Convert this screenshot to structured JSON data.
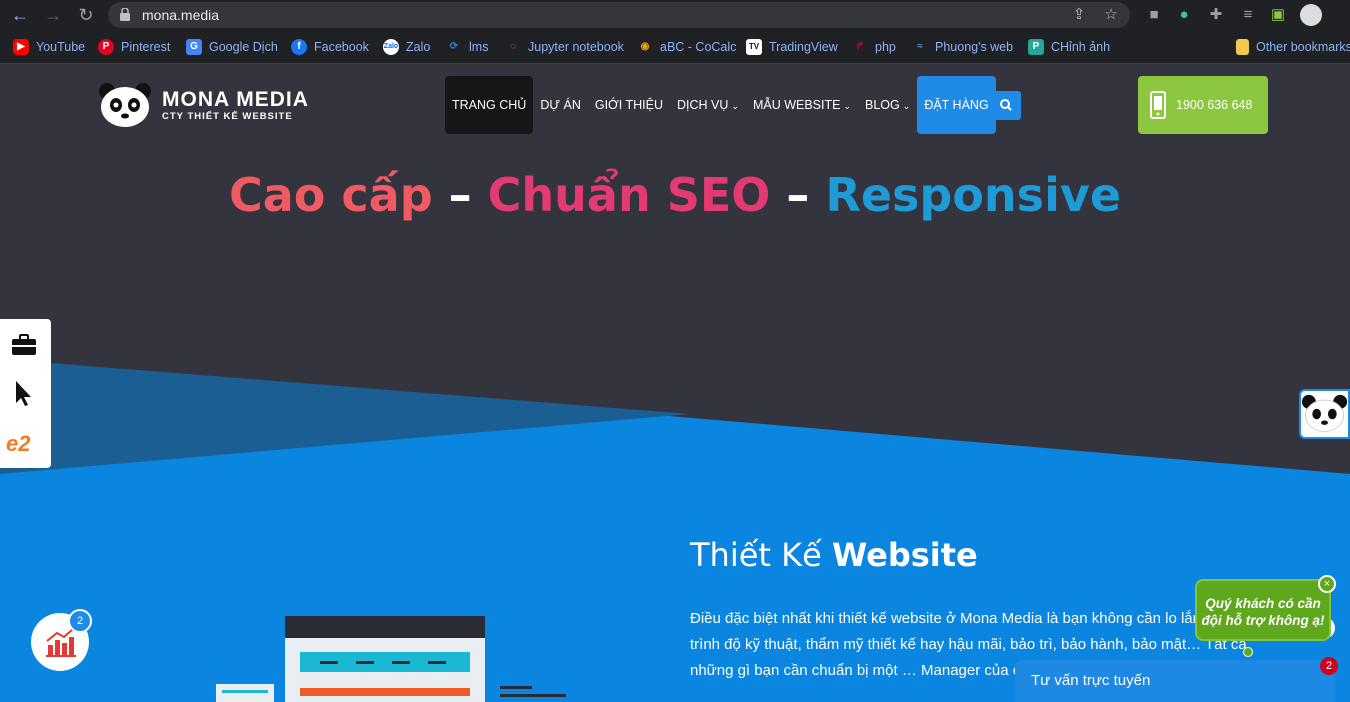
{
  "browser": {
    "url": "mona.media",
    "bookmarks": [
      {
        "label": "YouTube",
        "icon": "youtube-icon",
        "color": "#ff0000"
      },
      {
        "label": "Pinterest",
        "icon": "pinterest-icon",
        "color": "#e60023"
      },
      {
        "label": "Google Dịch",
        "icon": "google-translate-icon",
        "color": "#4285f4"
      },
      {
        "label": "Facebook",
        "icon": "facebook-icon",
        "color": "#1877f2"
      },
      {
        "label": "Zalo",
        "icon": "zalo-icon",
        "color": "#0068ff"
      },
      {
        "label": "lms",
        "icon": "lms-icon",
        "color": "#1e88e5"
      },
      {
        "label": "Jupyter notebook",
        "icon": "jupyter-icon",
        "color": "#f37626"
      },
      {
        "label": "aBC - CoCalc",
        "icon": "cocalc-icon",
        "color": "#f4a300"
      },
      {
        "label": "TradingView",
        "icon": "tradingview-icon",
        "color": "#131722"
      },
      {
        "label": "php",
        "icon": "php-icon",
        "color": "#d0021b"
      },
      {
        "label": "Phuong's web",
        "icon": "web-icon",
        "color": "#4a90e2"
      },
      {
        "label": "CHỉnh ảnh",
        "icon": "photo-edit-icon",
        "color": "#26a69a"
      },
      {
        "label": "Other bookmarks",
        "icon": "folder-icon",
        "color": "#f4c84a"
      }
    ]
  },
  "header": {
    "logo_title": "MONA MEDIA",
    "logo_subtitle": "CTY THIẾT KẾ WEBSITE",
    "menu": [
      {
        "label": "TRANG CHỦ"
      },
      {
        "label": "DỰ ÁN"
      },
      {
        "label": "GIỚI THIỆU"
      },
      {
        "label": "DỊCH VỤ",
        "caret": "⌄"
      },
      {
        "label": "MẪU WEBSITE",
        "caret": "⌄"
      },
      {
        "label": "BLOG",
        "caret": "⌄"
      },
      {
        "label": "ĐẶT HÀNG"
      }
    ],
    "hotline": "1900 636 648"
  },
  "hero": {
    "part1": "Cao cấp",
    "sep1": " – ",
    "part2": "Chuẩn SEO",
    "sep2": " – ",
    "part3": "Responsive",
    "colors": {
      "part1": "#ef5a63",
      "part2": "#e33a72",
      "part3": "#1e9ad6",
      "sep": "#ffffff"
    }
  },
  "section": {
    "title_light": "Thiết Kế ",
    "title_bold": "Website",
    "body": "Điều đặc biệt nhất khi thiết kế website ở Mona Media là bạn không cần lo lắng về trình độ kỹ thuật, thẩm mỹ thiết kế hay hậu mãi, bảo trì, bảo hành, bảo mật… Tất cả những gì bạn cần chuẩn bị một … Manager của chúng tôi trao đổi tư vấn cho bạ"
  },
  "widgets": {
    "stats_badge": "2",
    "chat_prompt": "Quý khách có cần đội hỗ trợ không ạ!",
    "chat_close": "×",
    "chat_bar": "Tư vấn trực tuyến",
    "chat_badge": "2"
  },
  "colors": {
    "accent": "#1f8be6",
    "dark_bg": "#34343f",
    "hotline": "#8dc63f"
  }
}
